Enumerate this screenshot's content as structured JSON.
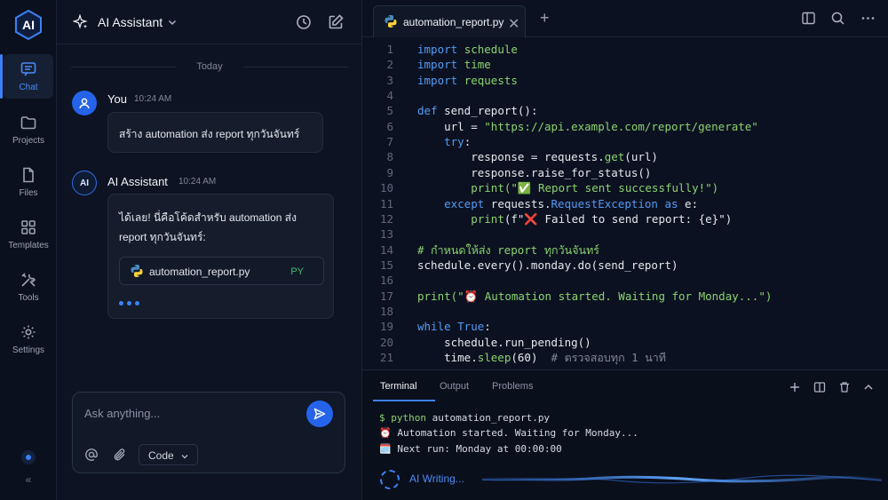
{
  "app": {
    "logo_text": "AI",
    "accent": "#3b82f6"
  },
  "rail": {
    "items": [
      {
        "label": "Chat",
        "icon": "chat-icon",
        "active": true
      },
      {
        "label": "Projects",
        "icon": "folder-icon",
        "active": false
      },
      {
        "label": "Files",
        "icon": "file-icon",
        "active": false
      },
      {
        "label": "Templates",
        "icon": "grid-icon",
        "active": false
      },
      {
        "label": "Tools",
        "icon": "tools-icon",
        "active": false
      },
      {
        "label": "Settings",
        "icon": "gear-icon",
        "active": false
      }
    ],
    "collapse_glyph": "«"
  },
  "chat": {
    "title": "AI Assistant",
    "date_divider": "Today",
    "messages": [
      {
        "sender": "You",
        "time": "10:24 AM",
        "text": "สร้าง automation ส่ง report ทุกวันจันทร์"
      },
      {
        "sender": "AI Assistant",
        "time": "10:24 AM",
        "text": "ได้เลย! นี่คือโค้ดสำหรับ automation ส่ง report ทุกวันจันทร์:",
        "attachment": {
          "name": "automation_report.py",
          "ext": "PY"
        }
      }
    ],
    "ai_avatar_text": "AI",
    "input_placeholder": "Ask anything...",
    "mode": "Code"
  },
  "editor": {
    "tab": {
      "name": "automation_report.py",
      "close_glyph": "✕",
      "add_glyph": "+"
    },
    "lines": [
      {
        "n": "1",
        "parts": [
          {
            "t": "import ",
            "c": "k"
          },
          {
            "t": "schedule",
            "c": "s"
          }
        ]
      },
      {
        "n": "2",
        "parts": [
          {
            "t": "import ",
            "c": "k"
          },
          {
            "t": "time",
            "c": "s"
          }
        ]
      },
      {
        "n": "3",
        "parts": [
          {
            "t": "import ",
            "c": "k"
          },
          {
            "t": "requests",
            "c": "s"
          }
        ]
      },
      {
        "n": "4",
        "parts": []
      },
      {
        "n": "5",
        "parts": [
          {
            "t": "def ",
            "c": "k"
          },
          {
            "t": "send_report():",
            "c": "f"
          }
        ]
      },
      {
        "n": "6",
        "parts": [
          {
            "t": "    url = ",
            "c": "i"
          },
          {
            "t": "\"https://api.example.com/report/generate\"",
            "c": "s"
          }
        ]
      },
      {
        "n": "7",
        "parts": [
          {
            "t": "    ",
            "c": "i"
          },
          {
            "t": "try",
            "c": "k"
          },
          {
            "t": ":",
            "c": "i"
          }
        ]
      },
      {
        "n": "8",
        "parts": [
          {
            "t": "        response = requests.",
            "c": "i"
          },
          {
            "t": "get",
            "c": "s"
          },
          {
            "t": "(url)",
            "c": "i"
          }
        ]
      },
      {
        "n": "9",
        "parts": [
          {
            "t": "        response.raise_for_status()",
            "c": "i"
          }
        ]
      },
      {
        "n": "10",
        "parts": [
          {
            "t": "        ",
            "c": "i"
          },
          {
            "t": "print",
            "c": "s"
          },
          {
            "t": "(\"✅ Report sent successfully!\")",
            "c": "s"
          }
        ]
      },
      {
        "n": "11",
        "parts": [
          {
            "t": "    ",
            "c": "i"
          },
          {
            "t": "except ",
            "c": "k"
          },
          {
            "t": "requests.",
            "c": "i"
          },
          {
            "t": "RequestException ",
            "c": "k"
          },
          {
            "t": "as ",
            "c": "k"
          },
          {
            "t": "e:",
            "c": "i"
          }
        ]
      },
      {
        "n": "12",
        "parts": [
          {
            "t": "        ",
            "c": "i"
          },
          {
            "t": "print",
            "c": "s"
          },
          {
            "t": "(f\"❌ Failed to send report: {e}\")",
            "c": "i"
          }
        ]
      },
      {
        "n": "13",
        "parts": []
      },
      {
        "n": "14",
        "parts": [
          {
            "t": "# กำหนดให้ส่ง report ทุกวันจันทร์",
            "c": "s"
          }
        ]
      },
      {
        "n": "15",
        "parts": [
          {
            "t": "schedule.every().monday.do(send_report)",
            "c": "i"
          }
        ]
      },
      {
        "n": "16",
        "parts": []
      },
      {
        "n": "17",
        "parts": [
          {
            "t": "print",
            "c": "s"
          },
          {
            "t": "(\"⏰ Automation started. Waiting for Monday...\")",
            "c": "s"
          }
        ]
      },
      {
        "n": "18",
        "parts": []
      },
      {
        "n": "19",
        "parts": [
          {
            "t": "while ",
            "c": "k"
          },
          {
            "t": "True",
            "c": "k"
          },
          {
            "t": ":",
            "c": "i"
          }
        ]
      },
      {
        "n": "20",
        "parts": [
          {
            "t": "    schedule.run_pending()",
            "c": "i"
          }
        ]
      },
      {
        "n": "21",
        "parts": [
          {
            "t": "    time.",
            "c": "i"
          },
          {
            "t": "sleep",
            "c": "s"
          },
          {
            "t": "(60)  ",
            "c": "i"
          },
          {
            "t": "# ตรวจสอบทุก 1 นาที",
            "c": "c"
          }
        ]
      }
    ]
  },
  "terminal": {
    "tabs": [
      "Terminal",
      "Output",
      "Problems"
    ],
    "prompt": "$ python",
    "command": " automation_report.py",
    "output": [
      "⏰ Automation started. Waiting for Monday...",
      "🗓️ Next run: Monday at 00:00:00"
    ],
    "status": "AI Writing..."
  }
}
